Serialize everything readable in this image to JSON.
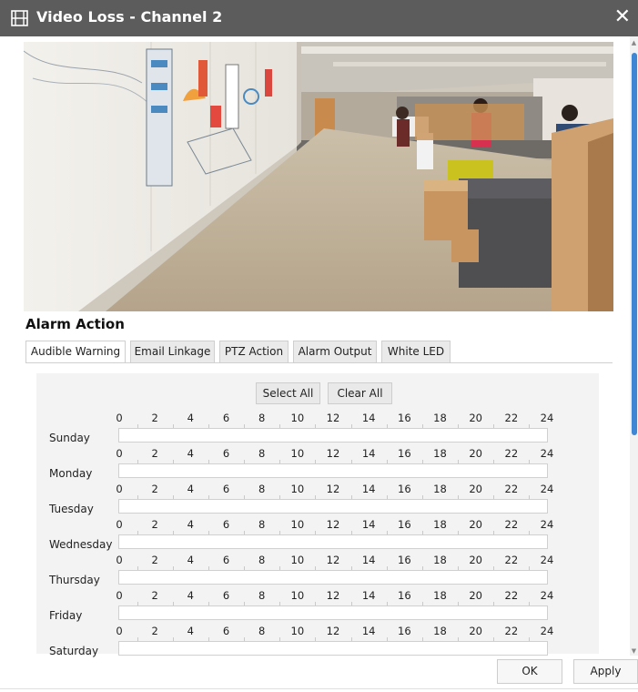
{
  "dialog": {
    "title": "Video Loss - Channel 2",
    "close_icon": "close-icon"
  },
  "alarm_action": {
    "title": "Alarm Action",
    "tabs": [
      {
        "label": "Audible Warning",
        "active": true
      },
      {
        "label": "Email Linkage",
        "active": false
      },
      {
        "label": "PTZ Action",
        "active": false
      },
      {
        "label": "Alarm Output",
        "active": false
      },
      {
        "label": "White LED",
        "active": false
      }
    ],
    "select_all_label": "Select All",
    "clear_all_label": "Clear All",
    "hours": [
      "0",
      "2",
      "4",
      "6",
      "8",
      "10",
      "12",
      "14",
      "16",
      "18",
      "20",
      "22",
      "24"
    ],
    "days": [
      "Sunday",
      "Monday",
      "Tuesday",
      "Wednesday",
      "Thursday",
      "Friday",
      "Saturday"
    ]
  },
  "footer": {
    "ok_label": "OK",
    "apply_label": "Apply"
  }
}
